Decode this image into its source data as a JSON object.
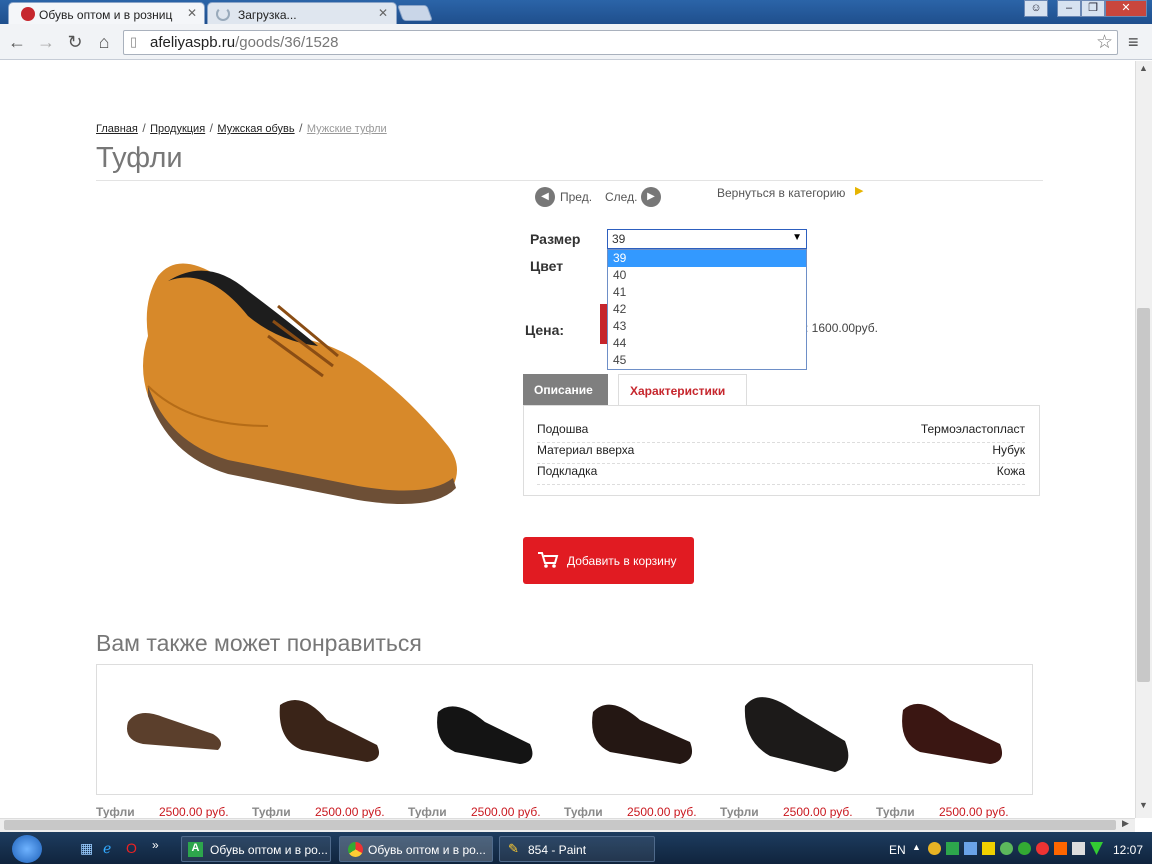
{
  "browser": {
    "tabs": [
      {
        "label": "Обувь оптом и в розниц"
      },
      {
        "label": "Загрузка..."
      }
    ],
    "url": {
      "host": "afeliyaspb.ru",
      "path": "/goods/36/1528"
    }
  },
  "breadcrumb": {
    "items": [
      "Главная",
      "Продукция",
      "Мужская обувь"
    ],
    "current": "Мужские туфли",
    "sep": "/"
  },
  "page_title": "Туфли",
  "nav": {
    "prev": "Пред.",
    "next": "След.",
    "back": "Вернуться в категорию"
  },
  "options": {
    "size_label": "Размер",
    "color_label": "Цвет",
    "size_selected": "39",
    "size_options": [
      "39",
      "40",
      "41",
      "42",
      "43",
      "44",
      "45"
    ]
  },
  "price": {
    "label": "Цена:",
    "partial_text": ": 1600.00руб."
  },
  "tabs": {
    "description": "Описание",
    "characteristics": "Характеристики"
  },
  "characteristics": [
    {
      "name": "Подошва",
      "value": "Термоэластопласт"
    },
    {
      "name": "Материал вверха",
      "value": "Нубук"
    },
    {
      "name": "Подкладка",
      "value": "Кожа"
    }
  ],
  "cart_button": "Добавить в корзину",
  "related": {
    "title": "Вам также может понравиться",
    "items": [
      {
        "name": "Туфли",
        "price": "2500.00 руб."
      },
      {
        "name": "Туфли",
        "price": "2500.00 руб."
      },
      {
        "name": "Туфли",
        "price": "2500.00 руб."
      },
      {
        "name": "Туфли",
        "price": "2500.00 руб."
      },
      {
        "name": "Туфли",
        "price": "2500.00 руб."
      },
      {
        "name": "Туфли",
        "price": "2500.00 руб."
      }
    ]
  },
  "taskbar": {
    "items": [
      {
        "label": "Обувь оптом и в ро..."
      },
      {
        "label": "Обувь оптом и в ро..."
      },
      {
        "label": "854 - Paint"
      }
    ],
    "lang": "EN",
    "time": "12:07"
  },
  "colors": {
    "accent": "#e11b22",
    "tab_active": "#c6262d",
    "selection": "#3399ff"
  }
}
